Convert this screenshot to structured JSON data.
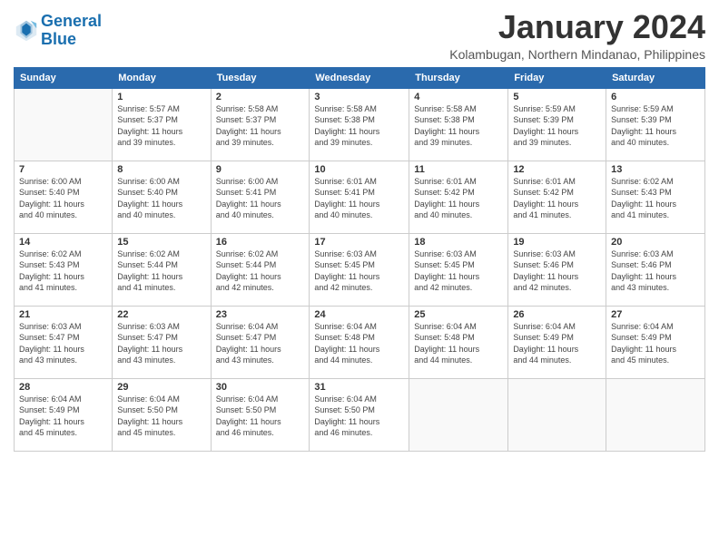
{
  "header": {
    "logo_line1": "General",
    "logo_line2": "Blue",
    "title": "January 2024",
    "subtitle": "Kolambugan, Northern Mindanao, Philippines"
  },
  "weekdays": [
    "Sunday",
    "Monday",
    "Tuesday",
    "Wednesday",
    "Thursday",
    "Friday",
    "Saturday"
  ],
  "weeks": [
    [
      {
        "day": "",
        "info": ""
      },
      {
        "day": "1",
        "info": "Sunrise: 5:57 AM\nSunset: 5:37 PM\nDaylight: 11 hours\nand 39 minutes."
      },
      {
        "day": "2",
        "info": "Sunrise: 5:58 AM\nSunset: 5:37 PM\nDaylight: 11 hours\nand 39 minutes."
      },
      {
        "day": "3",
        "info": "Sunrise: 5:58 AM\nSunset: 5:38 PM\nDaylight: 11 hours\nand 39 minutes."
      },
      {
        "day": "4",
        "info": "Sunrise: 5:58 AM\nSunset: 5:38 PM\nDaylight: 11 hours\nand 39 minutes."
      },
      {
        "day": "5",
        "info": "Sunrise: 5:59 AM\nSunset: 5:39 PM\nDaylight: 11 hours\nand 39 minutes."
      },
      {
        "day": "6",
        "info": "Sunrise: 5:59 AM\nSunset: 5:39 PM\nDaylight: 11 hours\nand 40 minutes."
      }
    ],
    [
      {
        "day": "7",
        "info": "Sunrise: 6:00 AM\nSunset: 5:40 PM\nDaylight: 11 hours\nand 40 minutes."
      },
      {
        "day": "8",
        "info": "Sunrise: 6:00 AM\nSunset: 5:40 PM\nDaylight: 11 hours\nand 40 minutes."
      },
      {
        "day": "9",
        "info": "Sunrise: 6:00 AM\nSunset: 5:41 PM\nDaylight: 11 hours\nand 40 minutes."
      },
      {
        "day": "10",
        "info": "Sunrise: 6:01 AM\nSunset: 5:41 PM\nDaylight: 11 hours\nand 40 minutes."
      },
      {
        "day": "11",
        "info": "Sunrise: 6:01 AM\nSunset: 5:42 PM\nDaylight: 11 hours\nand 40 minutes."
      },
      {
        "day": "12",
        "info": "Sunrise: 6:01 AM\nSunset: 5:42 PM\nDaylight: 11 hours\nand 41 minutes."
      },
      {
        "day": "13",
        "info": "Sunrise: 6:02 AM\nSunset: 5:43 PM\nDaylight: 11 hours\nand 41 minutes."
      }
    ],
    [
      {
        "day": "14",
        "info": "Sunrise: 6:02 AM\nSunset: 5:43 PM\nDaylight: 11 hours\nand 41 minutes."
      },
      {
        "day": "15",
        "info": "Sunrise: 6:02 AM\nSunset: 5:44 PM\nDaylight: 11 hours\nand 41 minutes."
      },
      {
        "day": "16",
        "info": "Sunrise: 6:02 AM\nSunset: 5:44 PM\nDaylight: 11 hours\nand 42 minutes."
      },
      {
        "day": "17",
        "info": "Sunrise: 6:03 AM\nSunset: 5:45 PM\nDaylight: 11 hours\nand 42 minutes."
      },
      {
        "day": "18",
        "info": "Sunrise: 6:03 AM\nSunset: 5:45 PM\nDaylight: 11 hours\nand 42 minutes."
      },
      {
        "day": "19",
        "info": "Sunrise: 6:03 AM\nSunset: 5:46 PM\nDaylight: 11 hours\nand 42 minutes."
      },
      {
        "day": "20",
        "info": "Sunrise: 6:03 AM\nSunset: 5:46 PM\nDaylight: 11 hours\nand 43 minutes."
      }
    ],
    [
      {
        "day": "21",
        "info": "Sunrise: 6:03 AM\nSunset: 5:47 PM\nDaylight: 11 hours\nand 43 minutes."
      },
      {
        "day": "22",
        "info": "Sunrise: 6:03 AM\nSunset: 5:47 PM\nDaylight: 11 hours\nand 43 minutes."
      },
      {
        "day": "23",
        "info": "Sunrise: 6:04 AM\nSunset: 5:47 PM\nDaylight: 11 hours\nand 43 minutes."
      },
      {
        "day": "24",
        "info": "Sunrise: 6:04 AM\nSunset: 5:48 PM\nDaylight: 11 hours\nand 44 minutes."
      },
      {
        "day": "25",
        "info": "Sunrise: 6:04 AM\nSunset: 5:48 PM\nDaylight: 11 hours\nand 44 minutes."
      },
      {
        "day": "26",
        "info": "Sunrise: 6:04 AM\nSunset: 5:49 PM\nDaylight: 11 hours\nand 44 minutes."
      },
      {
        "day": "27",
        "info": "Sunrise: 6:04 AM\nSunset: 5:49 PM\nDaylight: 11 hours\nand 45 minutes."
      }
    ],
    [
      {
        "day": "28",
        "info": "Sunrise: 6:04 AM\nSunset: 5:49 PM\nDaylight: 11 hours\nand 45 minutes."
      },
      {
        "day": "29",
        "info": "Sunrise: 6:04 AM\nSunset: 5:50 PM\nDaylight: 11 hours\nand 45 minutes."
      },
      {
        "day": "30",
        "info": "Sunrise: 6:04 AM\nSunset: 5:50 PM\nDaylight: 11 hours\nand 46 minutes."
      },
      {
        "day": "31",
        "info": "Sunrise: 6:04 AM\nSunset: 5:50 PM\nDaylight: 11 hours\nand 46 minutes."
      },
      {
        "day": "",
        "info": ""
      },
      {
        "day": "",
        "info": ""
      },
      {
        "day": "",
        "info": ""
      }
    ]
  ]
}
